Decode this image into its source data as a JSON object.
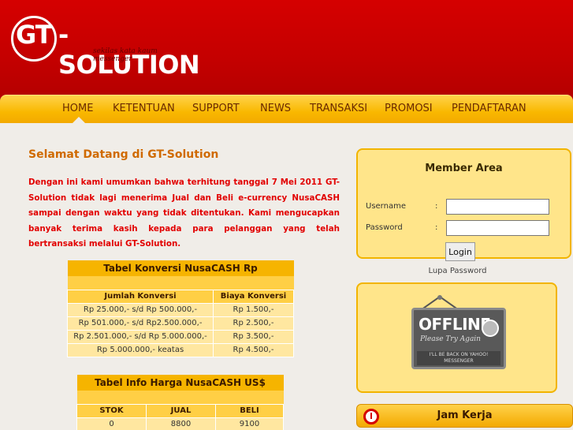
{
  "header": {
    "logo_gt": "GT",
    "logo_name": "-SOLUTION",
    "tagline": "sekilas kata kaum messenger"
  },
  "nav": {
    "items": [
      "HOME",
      "KETENTUAN",
      "SUPPORT",
      "NEWS",
      "TRANSAKSI",
      "PROMOSI",
      "PENDAFTARAN"
    ],
    "active": "HOME"
  },
  "main": {
    "welcome": "Selamat Datang di GT-Solution",
    "intro": "Dengan ini kami umumkan bahwa terhitung tanggal 7 Mei 2011 GT-Solution tidak lagi menerima Jual dan Beli e-currency NusaCASH sampai dengan waktu yang tidak ditentukan. Kami mengucapkan banyak terima kasih kepada para pelanggan yang telah bertransaksi melalui GT-Solution."
  },
  "table_konversi": {
    "title": "Tabel Konversi NusaCASH Rp",
    "headers": [
      "Jumlah Konversi",
      "Biaya Konversi"
    ],
    "rows": [
      [
        "Rp 25.000,- s/d Rp 500.000,-",
        "Rp 1.500,-"
      ],
      [
        "Rp 501.000,- s/d Rp2.500.000,-",
        "Rp 2.500,-"
      ],
      [
        "Rp 2.501.000,- s/d Rp 5.000.000,-",
        "Rp 3.500,-"
      ],
      [
        "Rp 5.000.000,- keatas",
        "Rp 4.500,-"
      ]
    ]
  },
  "table_harga": {
    "title": "Tabel Info Harga NusaCASH US$",
    "headers": [
      "STOK",
      "JUAL",
      "BELI"
    ],
    "rows": [
      [
        "0",
        "8800",
        "9100"
      ]
    ]
  },
  "member_area": {
    "title": "Member Area",
    "username_label": "Username",
    "password_label": "Password",
    "colon": ":",
    "username_value": "",
    "password_value": "",
    "login_label": "Login",
    "lupa_password": "Lupa Password"
  },
  "offline_sign": {
    "offline": "OFFLINE",
    "please": "Please Try Again",
    "yahoo": "I'LL BE BACK ON YAHOO! MESSENGER"
  },
  "jam_kerja": {
    "label": "Jam Kerja",
    "icon": "clock-icon"
  },
  "colors": {
    "header_red": "#c80000",
    "nav_yellow": "#f9b800",
    "panel_yellow": "#ffe58a",
    "intro_red": "#e20000",
    "welcome_orange": "#d06a00"
  }
}
